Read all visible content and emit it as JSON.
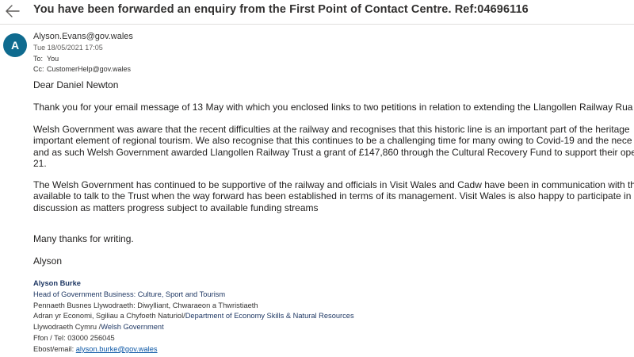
{
  "header": {
    "subject": "You have been forwarded an enquiry from the First Point of Contact Centre. Ref:04696116",
    "back_icon": "arrow-left-icon"
  },
  "message": {
    "avatar_letter": "A",
    "from": "Alyson.Evans@gov.wales",
    "date": "Tue 18/05/2021 17:05",
    "to_label": "To:",
    "to": "You",
    "cc_label": "Cc:",
    "cc": "CustomerHelp@gov.wales"
  },
  "body": {
    "greeting": "Dear Daniel Newton",
    "p1": "Thank you for your email message of 13 May with which you enclosed links to two petitions in relation to extending the Llangollen Railway Rua",
    "p2_l1": "Welsh Government was aware that the recent difficulties at the railway and recognises that this historic line is an important part of the heritage",
    "p2_l2": "important element of regional tourism.  We also recognise that this continues to be a challenging time for many owing to Covid-19 and the nece",
    "p2_l3": "and as such Welsh Government awarded Llangollen Railway Trust a grant of £147,860 through the Cultural Recovery Fund to support their ope",
    "p2_l4": "21.",
    "p3_l1": "The Welsh Government has continued to be supportive of the railway and officials in Visit Wales and Cadw have been in communication with th",
    "p3_l2": "available to talk to the Trust when the way forward has been established in terms of its management. Visit Wales is also happy to participate in",
    "p3_l3": "discussion as matters progress subject to available funding streams",
    "thanks": "Many thanks for writing.",
    "signoff": "Alyson"
  },
  "signature": {
    "name": "Alyson Burke",
    "title": "Head of Government Business: Culture, Sport and Tourism",
    "title_cy": "Pennaeth Busnes Llywodraeth: Diwylliant, Chwaraeon a Thwristiaeth",
    "dept_cy": "Adran yr Economi, Sgiliau a Chyfoeth Naturiol/",
    "dept_en": "Department of Economy Skills & Natural Resources",
    "org_cy": "Llywodraeth Cymru /",
    "org_en": "Welsh Government",
    "phone": "Ffon / Tel: 03000 256045",
    "email_label": "Ebost/email: ",
    "email": "alyson.burke@gov.wales"
  }
}
